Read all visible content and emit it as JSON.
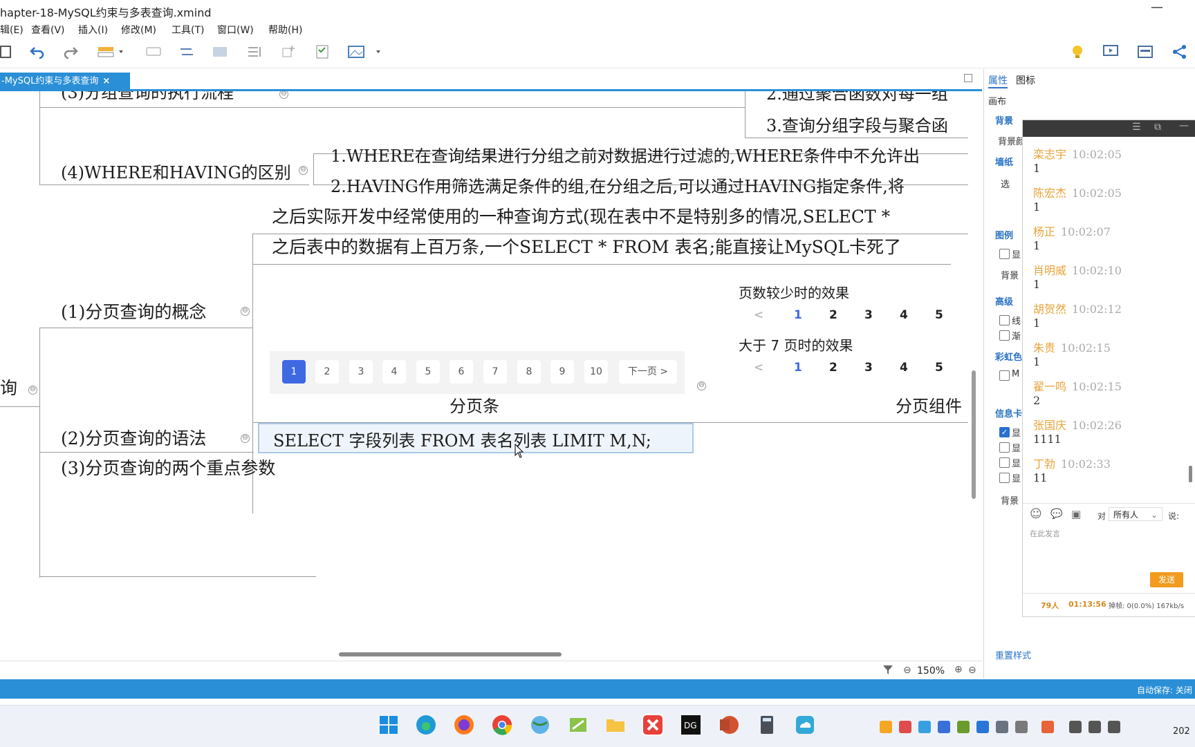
{
  "window": {
    "title": "hapter-18-MySQL约束与多表查询.xmind",
    "minimize": "—"
  },
  "menu": [
    "辑(E)",
    "查看(V)",
    "插入(I)",
    "修改(M)",
    "工具(T)",
    "窗口(W)",
    "帮助(H)"
  ],
  "tab": {
    "label": "-MySQL约束与多表查询",
    "close": "×"
  },
  "mindmap": {
    "node_group_exec": "(3)分组查询的执行流程",
    "right_top_1": "2.通过聚合函数对每一组",
    "right_top_2": "3.查询分组字段与聚合函",
    "where_having": "(4)WHERE和HAVING的区别",
    "where_detail": "1.WHERE在查询结果进行分组之前对数据进行过滤的,WHERE条件中不允许出",
    "having_detail": "2.HAVING作用筛选满足条件的组,在分组之后,可以通过HAVING指定条件,将",
    "paging_text_1": "之后实际开发中经常使用的一种查询方式(现在表中不是特别多的情况,SELECT *",
    "paging_text_2": "之后表中的数据有上百万条,一个SELECT * FROM 表名;能直接让MySQL卡死了",
    "paging_concept": "(1)分页查询的概念",
    "root_partial": "询",
    "paging_syntax": "(2)分页查询的语法",
    "paging_syntax_code": "SELECT 字段列表 FROM 表名列表 LIMIT M,N;",
    "paging_params": "(3)分页查询的两个重点参数",
    "pager_caption": "分页条",
    "component_caption": "分页组件",
    "few_pages_title": "页数较少时的效果",
    "many_pages_title": "大于 7 页时的效果",
    "component_prev": "<",
    "component_pages": [
      "1",
      "2",
      "3",
      "4",
      "5"
    ],
    "pager_pages": [
      "1",
      "2",
      "3",
      "4",
      "5",
      "6",
      "7",
      "8",
      "9",
      "10"
    ],
    "pager_next": "下一页 >",
    "collapse_symbol": "⊖"
  },
  "canvas_status": {
    "zoom": "150%"
  },
  "statusbar": {
    "autosave": "自动保存: 关闭"
  },
  "right_panel": {
    "tabs": [
      "属性",
      "图标"
    ],
    "section_canvas": "画布",
    "labels": [
      "背景",
      "背景颜",
      "墙纸",
      "选",
      "图例",
      "显",
      "背景",
      "高级",
      "线",
      "渐",
      "彩虹色",
      "M",
      "信息卡",
      "显",
      "显",
      "显",
      "显",
      "背景"
    ],
    "reset_style": "重置样式"
  },
  "chat": {
    "messages": [
      {
        "name": "栾志宇",
        "time": "10:02:05",
        "text": "1"
      },
      {
        "name": "陈宏杰",
        "time": "10:02:05",
        "text": "1"
      },
      {
        "name": "杨正",
        "time": "10:02:07",
        "text": "1"
      },
      {
        "name": "肖明威",
        "time": "10:02:10",
        "text": "1"
      },
      {
        "name": "胡贺然",
        "time": "10:02:12",
        "text": "1"
      },
      {
        "name": "朱贵",
        "time": "10:02:15",
        "text": "1"
      },
      {
        "name": "翟一鸣",
        "time": "10:02:15",
        "text": "2"
      },
      {
        "name": "张国庆",
        "time": "10:02:26",
        "text": "1111"
      },
      {
        "name": "丁勃",
        "time": "10:02:33",
        "text": "11"
      }
    ],
    "to_label": "对",
    "recipient": "所有人",
    "say_label": "说:",
    "input_placeholder": "在此发言",
    "send": "发送",
    "online_count": "79人",
    "duration": "01:13:56",
    "stats": "掉帧: 0(0.0%) 167kb/s"
  },
  "taskbar": {
    "clock": "202"
  },
  "colors": {
    "accent": "#2a8fd6",
    "pager_active": "#3f68e3",
    "chat_name": "#e8a33a",
    "send_button": "#f29b1f"
  }
}
